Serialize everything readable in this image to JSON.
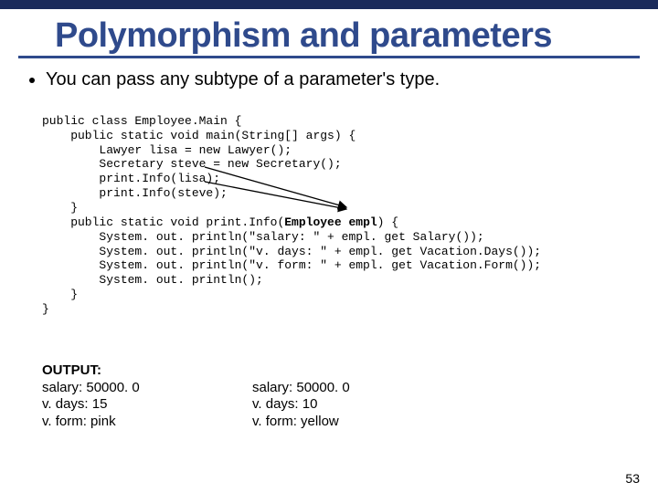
{
  "slide": {
    "title": "Polymorphism and parameters",
    "bullet": "You can pass any subtype of a parameter's type.",
    "code": {
      "l1": "public class Employee.Main {",
      "l2": "    public static void main(String[] args) {",
      "l3": "        Lawyer lisa = new Lawyer();",
      "l4": "        Secretary steve = new Secretary();",
      "l5": "        print.Info(lisa);",
      "l6": "        print.Info(steve);",
      "l7": "    }",
      "l8": "    public static void print.Info(",
      "l8b": "Employee empl",
      "l8c": ") {",
      "l9": "        System. out. println(\"salary: \" + empl. get Salary());",
      "l10": "        System. out. println(\"v. days: \" + empl. get Vacation.Days());",
      "l11": "        System. out. println(\"v. form: \" + empl. get Vacation.Form());",
      "l12": "        System. out. println();",
      "l13": "    }",
      "l14": "}"
    },
    "output_label": "OUTPUT:",
    "output_left": "salary: 50000. 0\nv. days: 15\nv. form: pink",
    "output_right": "salary: 50000. 0\nv. days: 10\nv. form: yellow",
    "page_number": "53"
  }
}
